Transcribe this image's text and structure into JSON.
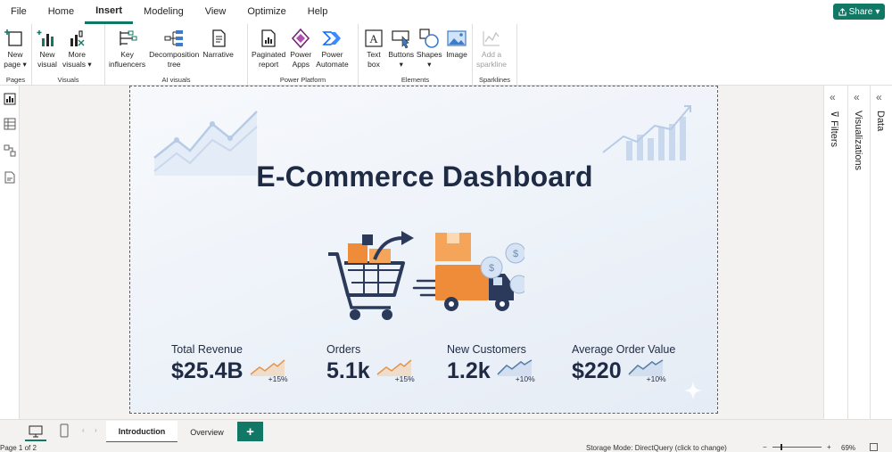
{
  "menu": {
    "items": [
      {
        "label": "File",
        "active": false
      },
      {
        "label": "Home",
        "active": false
      },
      {
        "label": "Insert",
        "active": true
      },
      {
        "label": "Modeling",
        "active": false
      },
      {
        "label": "View",
        "active": false
      },
      {
        "label": "Optimize",
        "active": false
      },
      {
        "label": "Help",
        "active": false
      }
    ],
    "share_label": "Share",
    "accent_color": "#117865"
  },
  "ribbon": {
    "groups": [
      {
        "label": "Pages",
        "buttons": [
          {
            "label": "New\npage ▾",
            "icon": "new-page-icon"
          }
        ]
      },
      {
        "label": "Visuals",
        "buttons": [
          {
            "label": "New\nvisual",
            "icon": "new-visual-icon"
          },
          {
            "label": "More\nvisuals ▾",
            "icon": "more-visuals-icon"
          }
        ]
      },
      {
        "label": "AI visuals",
        "buttons": [
          {
            "label": "Key\ninfluencers",
            "icon": "key-influencers-icon"
          },
          {
            "label": "Decomposition\ntree",
            "icon": "decomposition-tree-icon"
          },
          {
            "label": "Narrative",
            "icon": "narrative-icon"
          }
        ]
      },
      {
        "label": "Power Platform",
        "buttons": [
          {
            "label": "Paginated\nreport",
            "icon": "paginated-report-icon"
          },
          {
            "label": "Power\nApps",
            "icon": "power-apps-icon"
          },
          {
            "label": "Power\nAutomate",
            "icon": "power-automate-icon"
          }
        ]
      },
      {
        "label": "Elements",
        "buttons": [
          {
            "label": "Text\nbox",
            "icon": "text-box-icon"
          },
          {
            "label": "Buttons\n▾",
            "icon": "buttons-icon"
          },
          {
            "label": "Shapes\n▾",
            "icon": "shapes-icon"
          },
          {
            "label": "Image",
            "icon": "image-icon"
          }
        ]
      },
      {
        "label": "Sparklines",
        "buttons": [
          {
            "label": "Add a\nsparkline",
            "icon": "sparkline-icon",
            "disabled": true
          }
        ]
      }
    ]
  },
  "report": {
    "title": "E-Commerce Dashboard",
    "kpis": [
      {
        "label": "Total Revenue",
        "value": "$25.4B",
        "change": "+15%",
        "trend_color": "#e08a3c"
      },
      {
        "label": "Orders",
        "value": "5.1k",
        "change": "+15%",
        "trend_color": "#e08a3c"
      },
      {
        "label": "New Customers",
        "value": "1.2k",
        "change": "+10%",
        "trend_color": "#3d6b99"
      },
      {
        "label": "Average Order Value",
        "value": "$220",
        "change": "+10%",
        "trend_color": "#3d6b99"
      }
    ]
  },
  "panes": {
    "filters": "Filters",
    "visualizations": "Visualizations",
    "data": "Data"
  },
  "tabs": {
    "pages": [
      {
        "label": "Introduction",
        "active": true
      },
      {
        "label": "Overview",
        "active": false
      }
    ],
    "add_label": "+"
  },
  "status": {
    "page_info": "Page 1 of 2",
    "storage_mode": "Storage Mode: DirectQuery (click to change)",
    "zoom": "69%"
  }
}
